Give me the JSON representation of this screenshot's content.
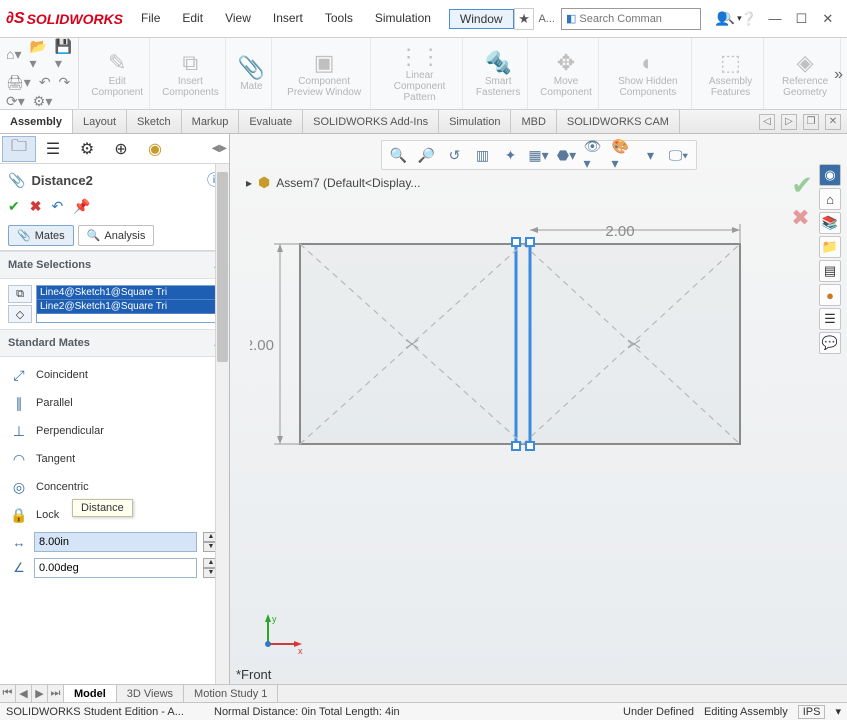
{
  "app": {
    "logo_text": "SOLIDWORKS"
  },
  "menu": {
    "file": "File",
    "edit": "Edit",
    "view": "View",
    "insert": "Insert",
    "tools": "Tools",
    "simulation": "Simulation",
    "window": "Window"
  },
  "search": {
    "placeholder": "Search Comman",
    "short": "A..."
  },
  "ribbon": {
    "edit_component": "Edit\nComponent",
    "insert_components": "Insert\nComponents",
    "mate": "Mate",
    "comp_preview": "Component\nPreview\nWindow",
    "linear_pattern": "Linear Component\nPattern",
    "smart_fasteners": "Smart\nFasteners",
    "move_component": "Move\nComponent",
    "show_hidden": "Show\nHidden\nComponents",
    "assembly_features": "Assembly\nFeatures",
    "reference_geometry": "Reference\nGeometry"
  },
  "tabs": [
    "Assembly",
    "Layout",
    "Sketch",
    "Markup",
    "Evaluate",
    "SOLIDWORKS Add-Ins",
    "Simulation",
    "MBD",
    "SOLIDWORKS CAM"
  ],
  "active_tab": "Assembly",
  "pm": {
    "title": "Distance2",
    "mates_tab": "Mates",
    "analysis_tab": "Analysis",
    "section_mate_sel": "Mate Selections",
    "selections": [
      "Line4@Sketch1@Square Tri",
      "Line2@Sketch1@Square Tri"
    ],
    "section_std": "Standard Mates",
    "std": {
      "coincident": "Coincident",
      "parallel": "Parallel",
      "perpendicular": "Perpendicular",
      "tangent": "Tangent",
      "concentric": "Concentric",
      "lock": "Lock"
    },
    "tooltip": "Distance",
    "distance_value": "8.00in",
    "angle_value": "0.00deg"
  },
  "gfx": {
    "breadcrumb": "Assem7  (Default<Display...",
    "dim_h": "2.00",
    "dim_v": "2.00",
    "view": "*Front"
  },
  "bottom_tabs": [
    "Model",
    "3D Views",
    "Motion Study 1"
  ],
  "active_bottom_tab": "Model",
  "status": {
    "edition": "SOLIDWORKS Student Edition - A...",
    "geom": "Normal Distance: 0in Total Length: 4in",
    "defined": "Under Defined",
    "mode": "Editing Assembly",
    "units": "IPS"
  }
}
